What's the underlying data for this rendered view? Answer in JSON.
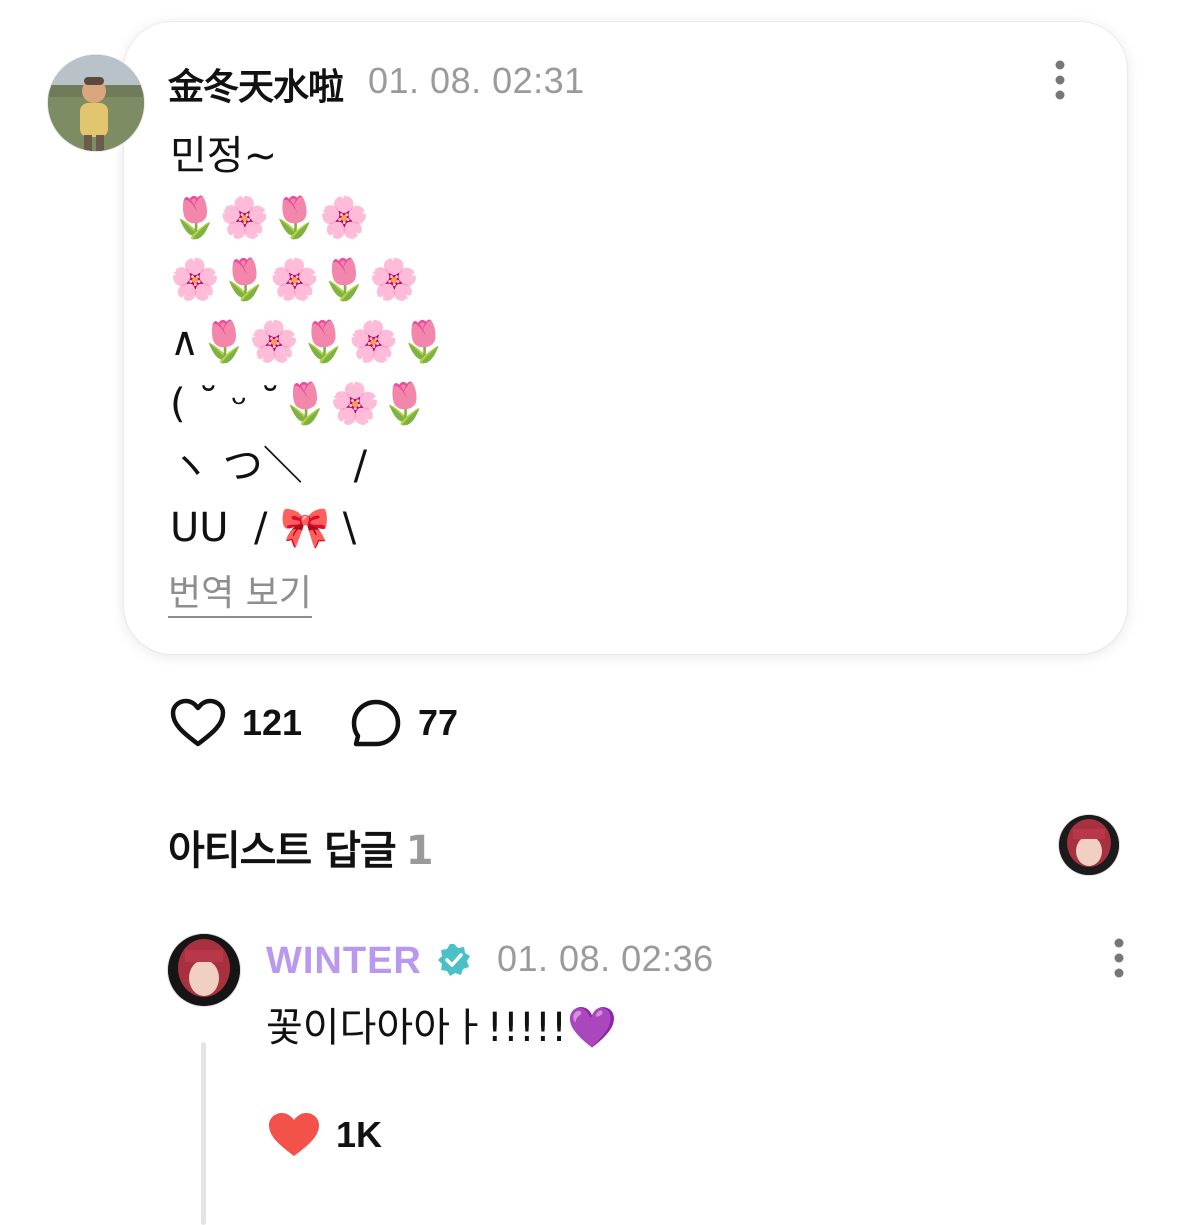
{
  "post": {
    "author": "金冬天水啦",
    "timestamp": "01. 08. 02:31",
    "body_lines": [
      "민정~",
      "🌷🌸🌷🌸",
      "🌸🌷🌸🌷🌸",
      "∧🌷🌸🌷🌸🌷",
      "( ˘ ᵕ ˘🌷🌸🌷",
      "ヽ つ＼    /",
      "UU  / 🎀 \\"
    ],
    "translate_label": "번역 보기",
    "more_icon": "more-vertical-icon",
    "avatar_icon": "user-avatar"
  },
  "actions": {
    "like_icon": "heart-outline-icon",
    "like_count": "121",
    "comment_icon": "comment-bubble-icon",
    "comment_count": "77"
  },
  "artist_replies": {
    "title": "아티스트 답글",
    "count": "1"
  },
  "reply": {
    "author": "WINTER",
    "author_color": "#b999f0",
    "verified_icon": "verified-badge-icon",
    "timestamp": "01. 08. 02:36",
    "body": "꽃이다아아ㅏ!!!!!💜",
    "like_icon": "heart-filled-icon",
    "like_color": "#f2524a",
    "like_count": "1K"
  }
}
